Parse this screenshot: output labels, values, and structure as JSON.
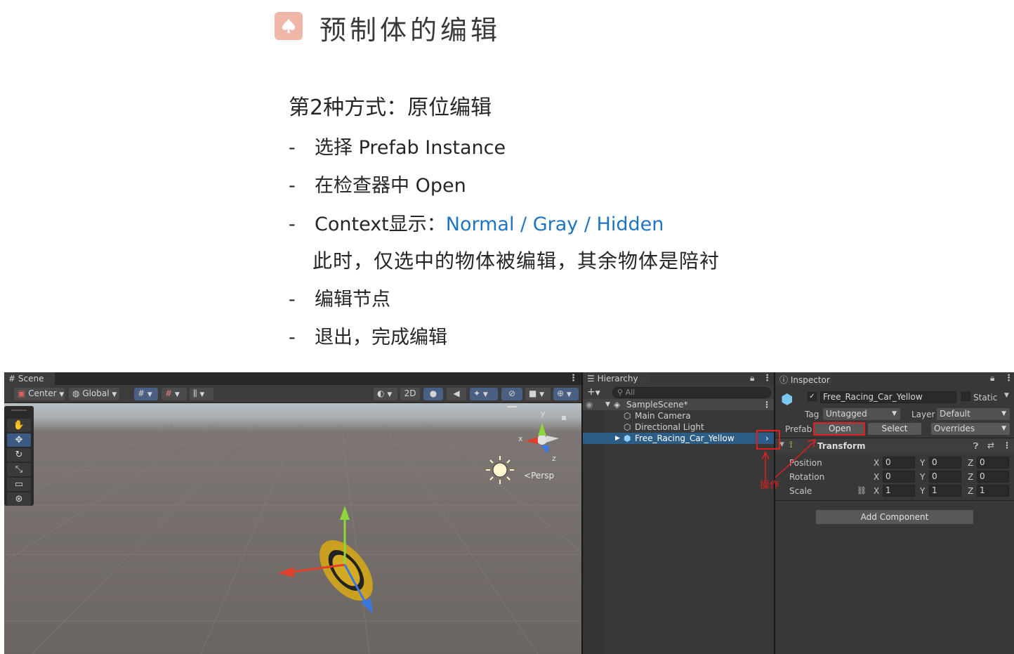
{
  "slide": {
    "title": "预制体的编辑",
    "subtitle": "第2种方式：原位编辑",
    "bullets": [
      {
        "dash": "-",
        "text": "选择 Prefab Instance"
      },
      {
        "dash": "-",
        "text": "在检查器中 Open"
      },
      {
        "dash": "-",
        "text": "Context显示：",
        "highlight": "Normal / Gray / Hidden"
      },
      {
        "dash": "-",
        "text": "编辑节点"
      },
      {
        "dash": "-",
        "text": "退出，完成编辑"
      }
    ],
    "note": "此时，仅选中的物体被编辑，其余物体是陪衬",
    "accent_color": "#1f74c4",
    "icon_color": "#f0b6a8"
  },
  "scene": {
    "tab_label": "Scene",
    "pivot_label": "Center",
    "space_label": "Global",
    "mode_2d_label": "2D",
    "axis_x": "x",
    "axis_y": "y",
    "axis_z": "z",
    "persp_label": "Persp"
  },
  "hierarchy": {
    "tab_label": "Hierarchy",
    "search_placeholder": "All",
    "scene_name": "SampleScene*",
    "items": [
      {
        "label": "Main Camera"
      },
      {
        "label": "Directional Light"
      },
      {
        "label": "Free_Racing_Car_Yellow"
      }
    ]
  },
  "inspector": {
    "tab_label": "Inspector",
    "object_name": "Free_Racing_Car_Yellow",
    "static_label": "Static",
    "tag_label": "Tag",
    "tag_value": "Untagged",
    "layer_label": "Layer",
    "layer_value": "Default",
    "prefab_label": "Prefab",
    "open_label": "Open",
    "select_label": "Select",
    "overrides_label": "Overrides",
    "transform_label": "Transform",
    "rows": [
      {
        "label": "Position",
        "x": "0",
        "y": "0",
        "z": "0"
      },
      {
        "label": "Rotation",
        "x": "0",
        "y": "0",
        "z": "0"
      },
      {
        "label": "Scale",
        "x": "1",
        "y": "1",
        "z": "1"
      }
    ],
    "axis_labels": {
      "x": "X",
      "y": "Y",
      "z": "Z"
    },
    "add_component_label": "Add Component"
  },
  "annotation": {
    "text": "操作",
    "color": "#e02020"
  }
}
